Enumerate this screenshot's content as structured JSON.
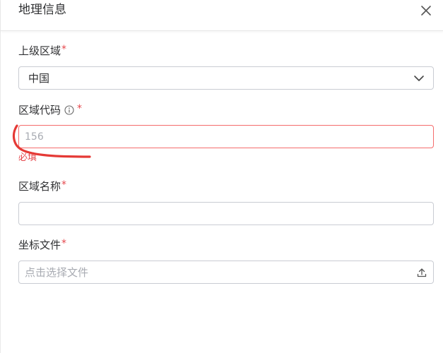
{
  "dialog": {
    "title": "地理信息"
  },
  "form": {
    "parent_region": {
      "label": "上级区域",
      "required_mark": "*",
      "value": "中国"
    },
    "region_code": {
      "label": "区域代码",
      "required_mark": "*",
      "placeholder": "156",
      "error": "必填"
    },
    "region_name": {
      "label": "区域名称",
      "required_mark": "*",
      "value": ""
    },
    "coord_file": {
      "label": "坐标文件",
      "required_mark": "*",
      "placeholder": "点击选择文件"
    }
  },
  "icons": {
    "close": "close-icon",
    "chevron": "chevron-down-icon",
    "info": "info-icon",
    "upload": "upload-icon"
  },
  "colors": {
    "required": "#e5484d",
    "error_border": "#f56c6c",
    "annotation": "#e53935",
    "border": "#c9ccd3"
  }
}
